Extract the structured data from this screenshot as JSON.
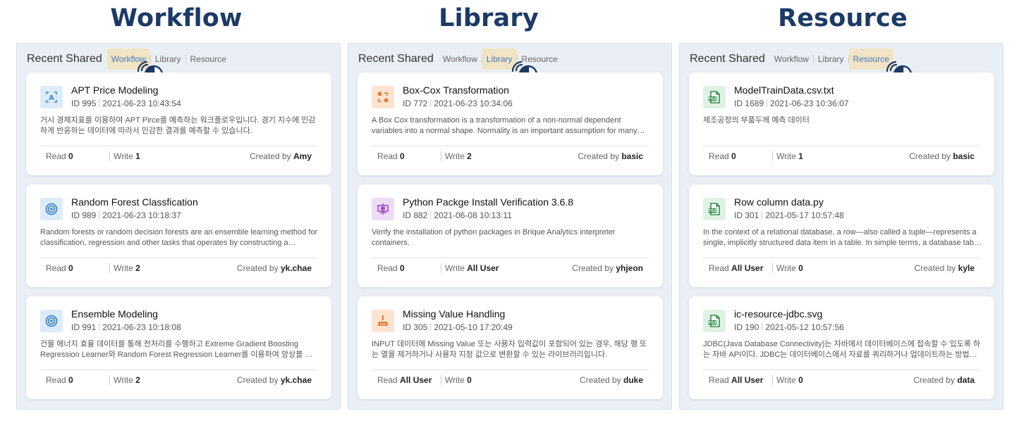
{
  "columns": [
    {
      "title": "Workflow",
      "header": "Recent Shared",
      "tabs": [
        "Workflow",
        "Library",
        "Resource"
      ],
      "active_tab": 0,
      "cards": [
        {
          "icon": "workflow-ai-icon",
          "icon_bg": "#dcecf9",
          "icon_color": "#3f88d1",
          "title": "APT Price Modeling",
          "id_label": "ID 995",
          "date": "2021-06-23 10:43:54",
          "desc": "거시 경제지표를 이용하여 APT Pirce를 예측하는 워크플로우입니다. 경기 지수에 민감하게 반응하는 데이터에 따라서 민감한 결과를 예측할 수 있습니다.",
          "read_label": "Read",
          "read": "0",
          "write_label": "Write",
          "write": "1",
          "created_label": "Created by",
          "created_by": "Amy"
        },
        {
          "icon": "target-icon",
          "icon_bg": "#dcecf9",
          "icon_color": "#2f7cc7",
          "title": "Random Forest Classfication",
          "id_label": "ID 989",
          "date": "2021-06-23 10:18:37",
          "desc": "Random forests or random decision forests are an ensemble learning method for classification, regression and other tasks that operates by constructing a multitude of decision trees.",
          "read_label": "Read",
          "read": "0",
          "write_label": "Write",
          "write": "2",
          "created_label": "Created by",
          "created_by": "yk.chae"
        },
        {
          "icon": "target-icon",
          "icon_bg": "#dcecf9",
          "icon_color": "#2f7cc7",
          "title": "Ensemble Modeling",
          "id_label": "ID 991",
          "date": "2021-06-23 10:18:08",
          "desc": "건물 에너지 효율 데이터를 통해 전처리를 수행하고 Extreme Gradient Boosting Regression Learner와 Random Forest Regression Learner를 이용하여 앙상블 모델을 생성합니다.",
          "read_label": "Read",
          "read": "0",
          "write_label": "Write",
          "write": "2",
          "created_label": "Created by",
          "created_by": "yk.chae"
        }
      ]
    },
    {
      "title": "Library",
      "header": "Recent Shared",
      "tabs": [
        "Workflow",
        "Library",
        "Resource"
      ],
      "active_tab": 1,
      "cards": [
        {
          "icon": "transform-icon",
          "icon_bg": "#fde3d0",
          "icon_color": "#e8782e",
          "title": "Box-Cox Transformation",
          "id_label": "ID 772",
          "date": "2021-06-23 10:34:06",
          "desc": "A Box Cox transformation is a transformation of a non-normal dependent variables into a normal shape. Normality is an important assumption for many statistical techniques.",
          "read_label": "Read",
          "read": "0",
          "write_label": "Write",
          "write": "2",
          "created_label": "Created by",
          "created_by": "basic"
        },
        {
          "icon": "package-icon",
          "icon_bg": "#eddcf6",
          "icon_color": "#9a4ccc",
          "title": "Python Packge Install Verification 3.6.8",
          "id_label": "ID 882",
          "date": "2021-06-08 10:13:11",
          "desc": "Verify the installation of python packages in Brique Analytics interpreter containers.",
          "read_label": "Read",
          "read": "0",
          "write_label": "Write",
          "write": "All User",
          "created_label": "Created by",
          "created_by": "yhjeon"
        },
        {
          "icon": "broom-icon",
          "icon_bg": "#fde3d0",
          "icon_color": "#e8782e",
          "title": "Missing Value Handling",
          "id_label": "ID 305",
          "date": "2021-05-10 17:20:49",
          "desc": "INPUT 데이터에 Missing Value 또는 사용자 입력값이 포함되어 있는 경우, 해당 행 또는 열을 제거하거나 사용자 지정 값으로 변환할 수 있는 라이브러리입니다.",
          "read_label": "Read",
          "read": "All User",
          "write_label": "Write",
          "write": "0",
          "created_label": "Created by",
          "created_by": "duke"
        }
      ]
    },
    {
      "title": "Resource",
      "header": "Recent Shared",
      "tabs": [
        "Workflow",
        "Library",
        "Resource"
      ],
      "active_tab": 2,
      "cards": [
        {
          "icon": "file-icon",
          "icon_bg": "#e1f1e3",
          "icon_color": "#2e8b4e",
          "title": "ModelTrainData.csv.txt",
          "id_label": "ID 1689",
          "date": "2021-06-23 10:36:07",
          "desc": "제조공정의 부품두께 예측 데이터",
          "read_label": "Read",
          "read": "0",
          "write_label": "Write",
          "write": "1",
          "created_label": "Created by",
          "created_by": "basic"
        },
        {
          "icon": "file-icon",
          "icon_bg": "#e1f1e3",
          "icon_color": "#2e8b4e",
          "title": "Row column data.py",
          "id_label": "ID 301",
          "date": "2021-05-17 10:57:48",
          "desc": "In the context of a relational database, a row—also called a tuple—represents a single, implicitly structured data item in a table. In simple terms, a database table can be thought of as consisting of rows and columns.",
          "read_label": "Read",
          "read": "All User",
          "write_label": "Write",
          "write": "0",
          "created_label": "Created by",
          "created_by": "kyle"
        },
        {
          "icon": "file-icon",
          "icon_bg": "#e1f1e3",
          "icon_color": "#2e8b4e",
          "title": "ic-resource-jdbc.svg",
          "id_label": "ID 190",
          "date": "2021-05-12 10:57:56",
          "desc": "JDBC(Java Database Connectivity)는 자바에서 데이터베이스에 접속할 수 있도록 하는 자바 API이다. JDBC는 데이터베이스에서 자료를 쿼리하거나 업데이트하는 방법을 제공한다.",
          "read_label": "Read",
          "read": "All User",
          "write_label": "Write",
          "write": "0",
          "created_label": "Created by",
          "created_by": "data"
        }
      ]
    }
  ]
}
